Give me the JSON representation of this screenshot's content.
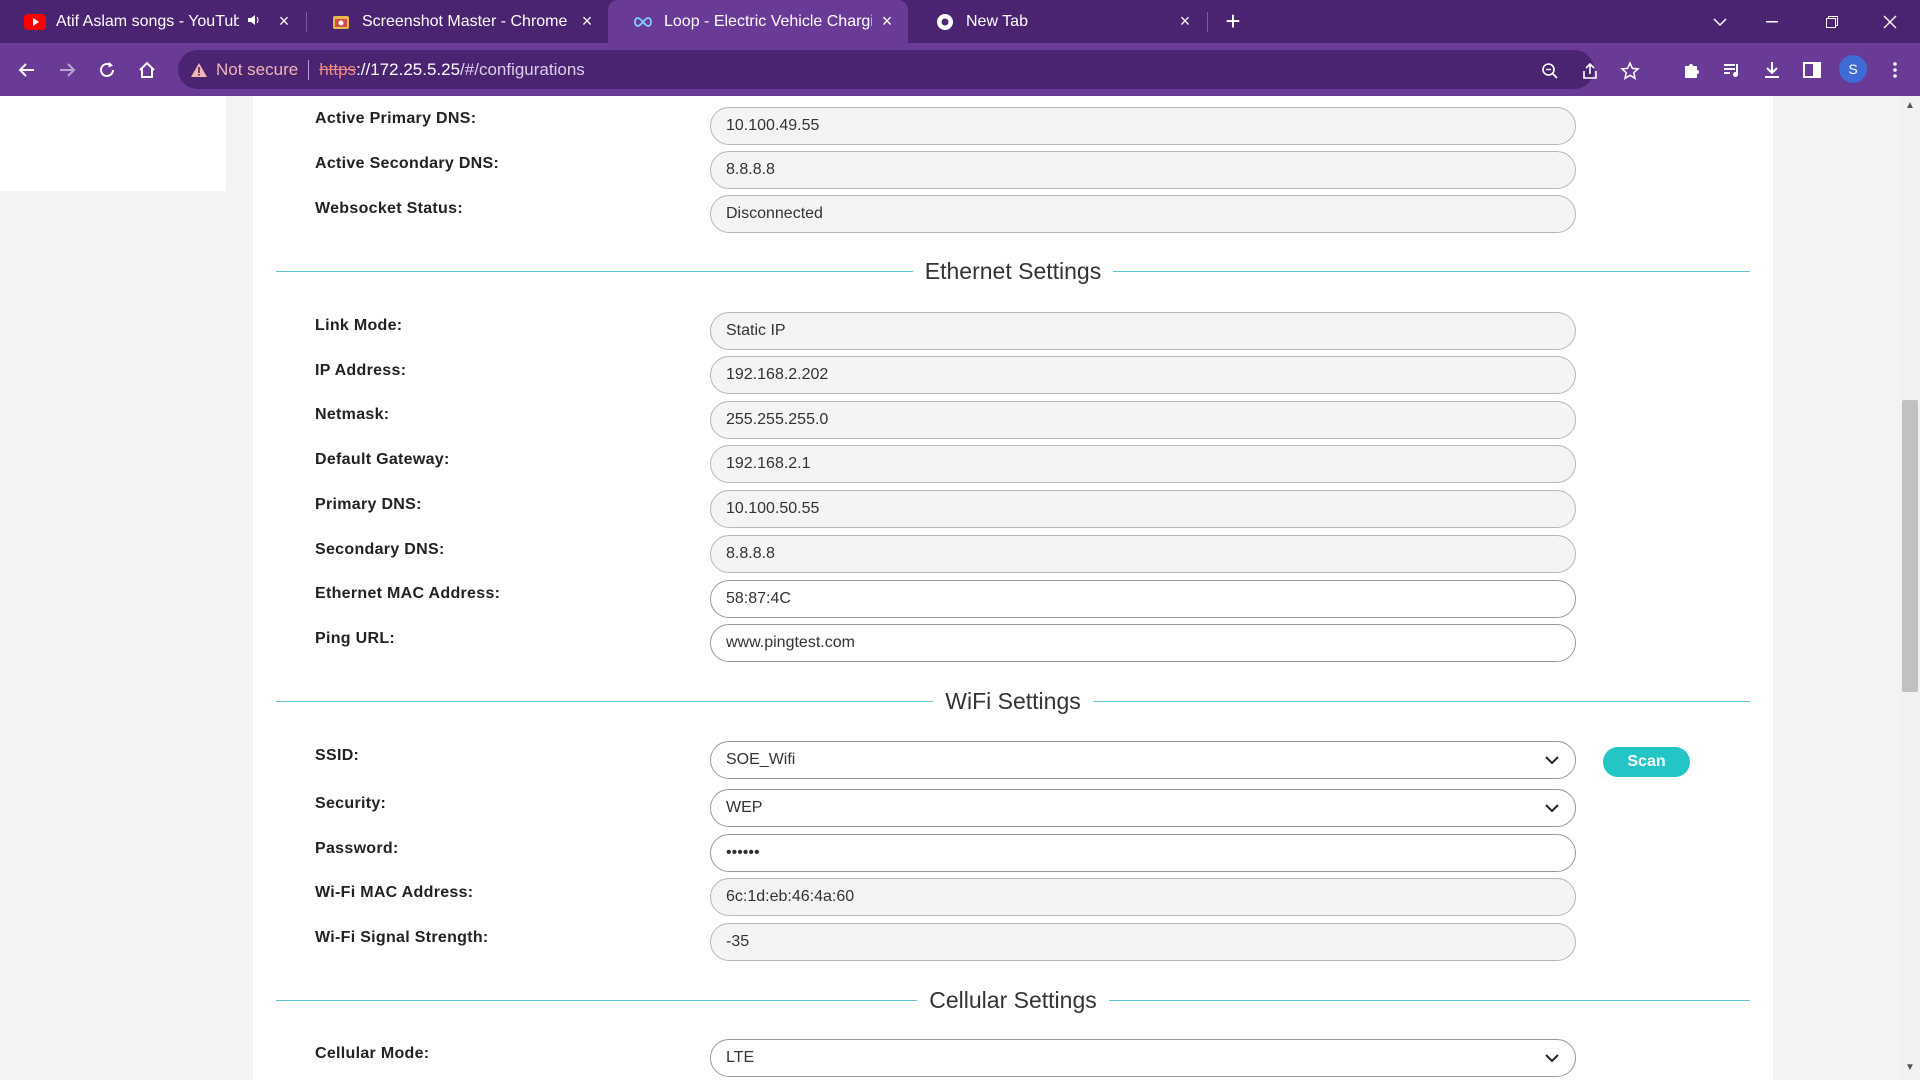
{
  "browser": {
    "tabs": [
      {
        "title": "Atif Aslam songs - YouTube",
        "icon": "youtube-icon",
        "active": false
      },
      {
        "title": "Screenshot Master - Chrome We",
        "icon": "screenshot-master-icon",
        "active": false
      },
      {
        "title": "Loop - Electric Vehicle Charging",
        "icon": "loop-infinity-icon",
        "active": true
      },
      {
        "title": "New Tab",
        "icon": "chrome-icon",
        "active": false
      }
    ],
    "omnibox": {
      "security_label": "Not secure",
      "url_scheme": "https",
      "url_host": "://172.25.5.25",
      "url_path": "/#/configurations"
    },
    "profile_initial": "S",
    "accent": "#6a3b96",
    "tabstrip_color": "#4a2470"
  },
  "config": {
    "status_rows": [
      {
        "label": "Active Primary DNS:",
        "value": "10.100.49.55"
      },
      {
        "label": "Active Secondary DNS:",
        "value": "8.8.8.8"
      },
      {
        "label": "Websocket Status:",
        "value": "Disconnected"
      }
    ],
    "ethernet": {
      "title": "Ethernet Settings",
      "rows": [
        {
          "label": "Link Mode:",
          "value": "Static IP"
        },
        {
          "label": "IP Address:",
          "value": "192.168.2.202"
        },
        {
          "label": "Netmask:",
          "value": "255.255.255.0"
        },
        {
          "label": "Default Gateway:",
          "value": "192.168.2.1"
        },
        {
          "label": "Primary DNS:",
          "value": "10.100.50.55"
        },
        {
          "label": "Secondary DNS:",
          "value": "8.8.8.8"
        },
        {
          "label": "Ethernet MAC Address:",
          "value": "58:87:4C"
        },
        {
          "label": "Ping URL:",
          "value": "www.pingtest.com"
        }
      ]
    },
    "wifi": {
      "title": "WiFi Settings",
      "ssid_label": "SSID:",
      "ssid_value": "SOE_Wifi",
      "scan_label": "Scan",
      "security_label": "Security:",
      "security_value": "WEP",
      "password_label": "Password:",
      "password_value": "••••••",
      "mac_label": "Wi-Fi MAC Address:",
      "mac_value": "6c:1d:eb:46:4a:60",
      "signal_label": "Wi-Fi Signal Strength:",
      "signal_value": "-35"
    },
    "cellular": {
      "title": "Cellular Settings",
      "mode_label": "Cellular Mode:",
      "mode_value": "LTE"
    },
    "scan_color": "#24c5c5",
    "divider_color": "#5ec7cf"
  }
}
